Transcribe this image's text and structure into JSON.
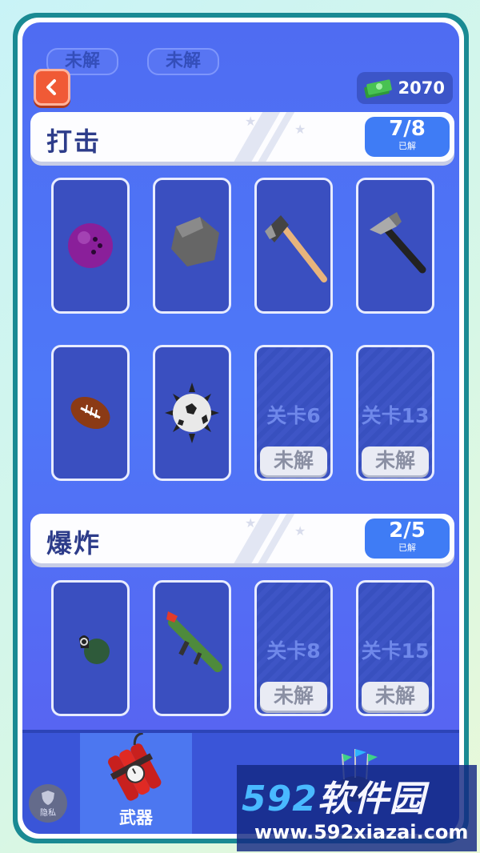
{
  "top_tabs": [
    "未解",
    "未解"
  ],
  "currency": {
    "amount": "2070"
  },
  "sections": [
    {
      "title": "打击",
      "count": "7/8",
      "count_label": "已解",
      "items": [
        {
          "name": "bowling-ball",
          "locked": false
        },
        {
          "name": "rock",
          "locked": false
        },
        {
          "name": "axe",
          "locked": false
        },
        {
          "name": "hammer",
          "locked": false
        },
        {
          "name": "football",
          "locked": false
        },
        {
          "name": "spiked-ball",
          "locked": false
        },
        {
          "name": "locked-level-6",
          "locked": true,
          "level": "关卡6",
          "status": "未解"
        },
        {
          "name": "locked-level-13",
          "locked": true,
          "level": "关卡13",
          "status": "未解"
        }
      ]
    },
    {
      "title": "爆炸",
      "count": "2/5",
      "count_label": "已解",
      "items": [
        {
          "name": "grenade",
          "locked": false
        },
        {
          "name": "rocket-launcher",
          "locked": false
        },
        {
          "name": "locked-level-8",
          "locked": true,
          "level": "关卡8",
          "status": "未解"
        },
        {
          "name": "locked-level-15",
          "locked": true,
          "level": "关卡15",
          "status": "未解"
        }
      ]
    }
  ],
  "nav": {
    "weapons_label": "武器",
    "privacy_label": "隐私"
  },
  "watermark": {
    "brand_num": "592",
    "brand_text": "软件园",
    "url": "www.592xiazai.com"
  },
  "colors": {
    "accent": "#4f6cf2",
    "back_button": "#f05a36",
    "counter": "#3f7cf5"
  },
  "icons": [
    "back-arrow-icon",
    "cash-icon",
    "dynamite-icon",
    "flags-icon",
    "shield-icon"
  ]
}
